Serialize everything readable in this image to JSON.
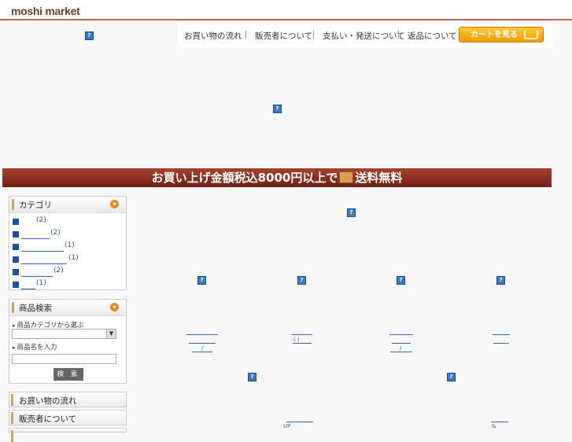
{
  "header": {
    "logo": "moshi market"
  },
  "nav": {
    "items": [
      "お買い物の流れ",
      "販売者について",
      "支払い・発送について",
      "返品について"
    ],
    "cart_button": "カートを見る"
  },
  "banner": {
    "text_before": "お買い上げ金額税込8000円以上で",
    "text_after": "送料無料"
  },
  "category_panel": {
    "title": "カテゴリ",
    "items": [
      {
        "count": "(2)"
      },
      {
        "count": "(2)"
      },
      {
        "count": "(1)"
      },
      {
        "count": "(1)"
      },
      {
        "count": "(2)"
      },
      {
        "count": "(1)"
      }
    ]
  },
  "search_panel": {
    "title": "商品検索",
    "category_label": "商品カテゴリから選ぶ",
    "name_label": "商品名を入力",
    "search_button": "検 索"
  },
  "side_menu": [
    "お買い物の流れ",
    "販売者について"
  ],
  "product_text": {
    "slash1": "/",
    "paren": "(   )",
    "slash2": "/",
    "up": "UP",
    "amp": "&"
  },
  "icons": {
    "broken_image": "?"
  },
  "colors": {
    "accent": "#b0685b",
    "cart": "#f29a00",
    "link": "#3565b0",
    "banner": "#8a2e21"
  }
}
